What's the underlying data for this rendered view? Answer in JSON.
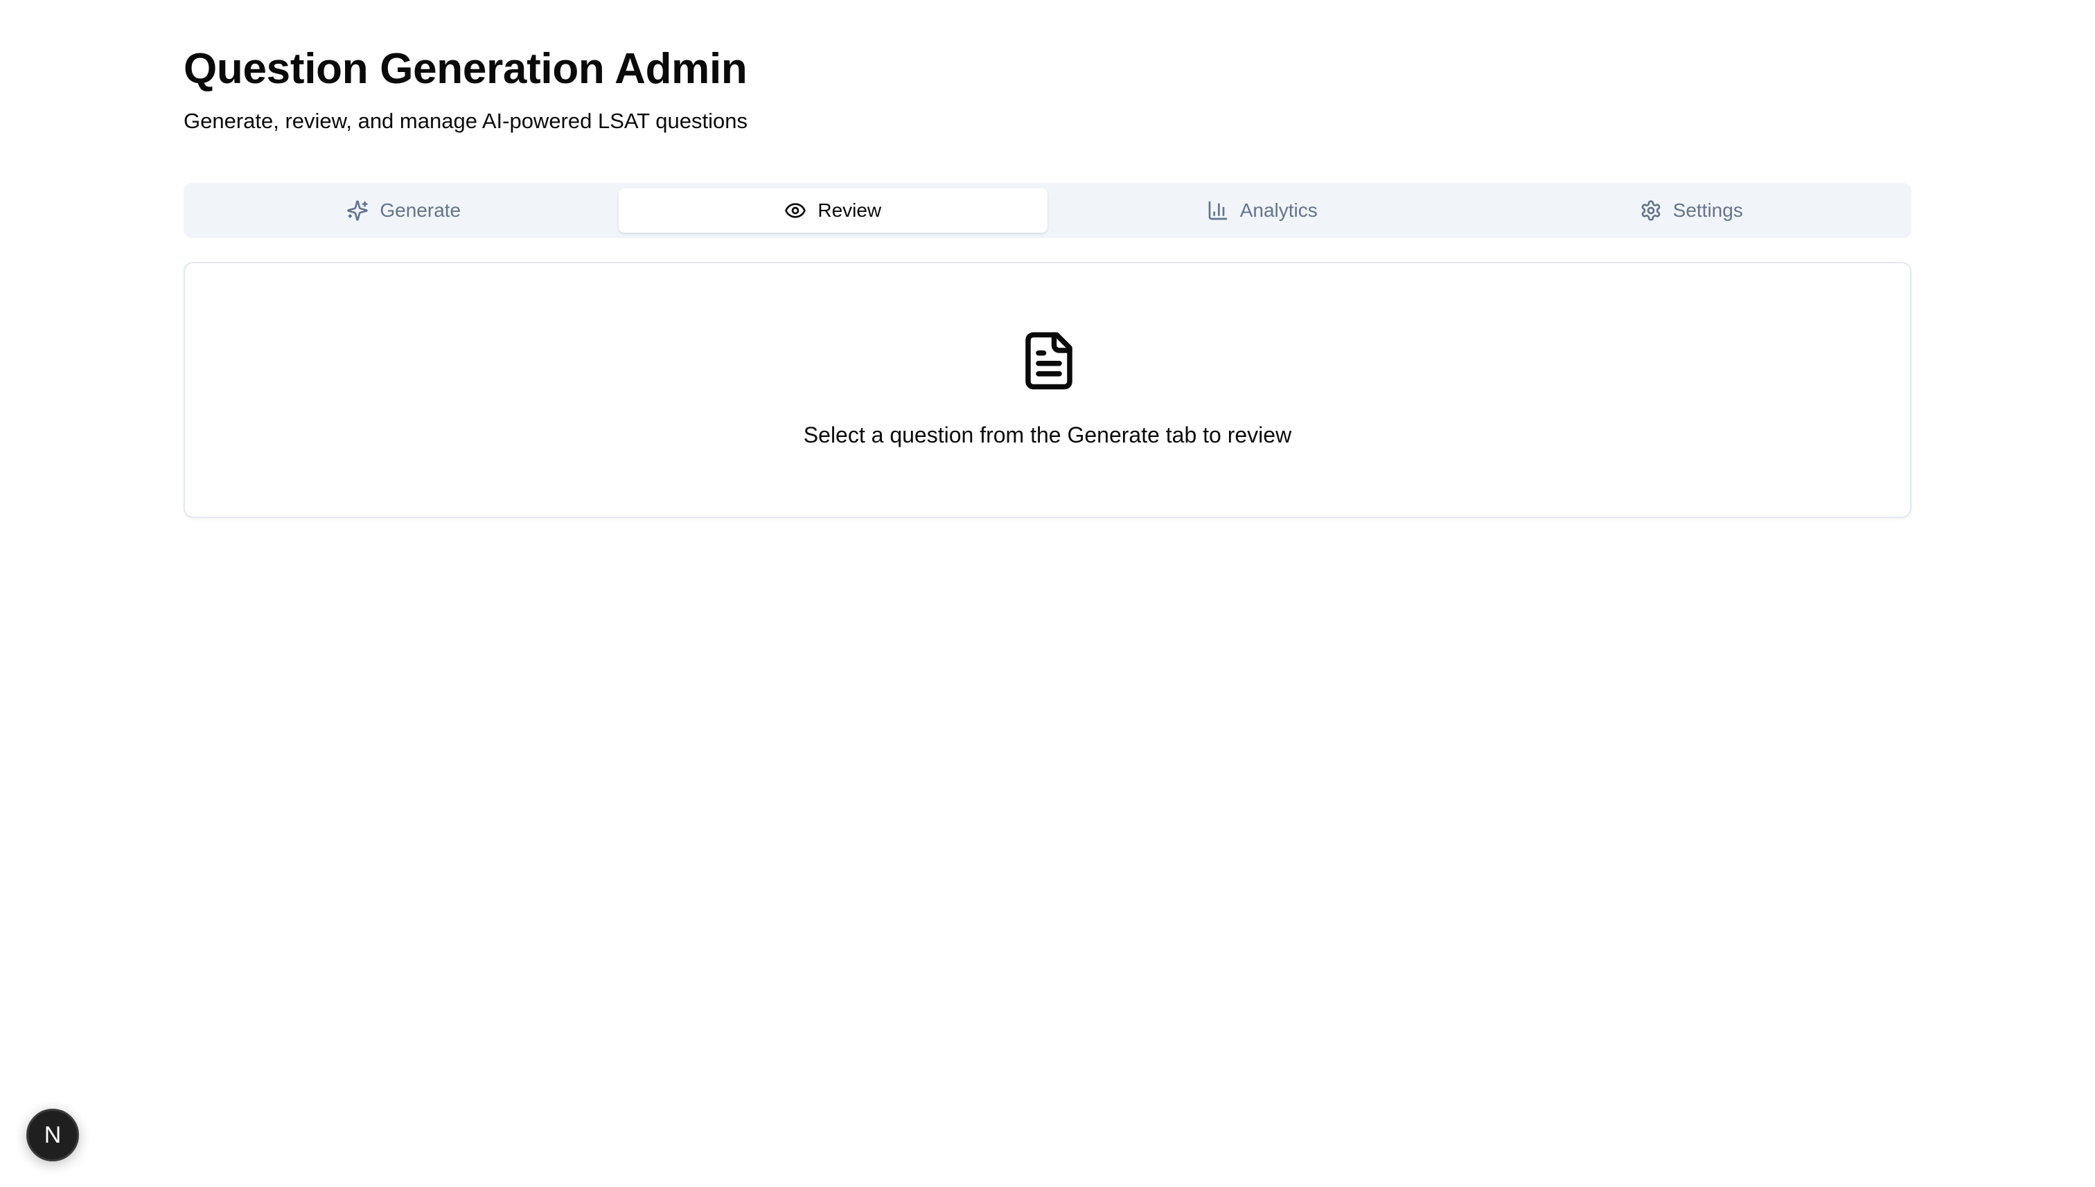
{
  "header": {
    "title": "Question Generation Admin",
    "subtitle": "Generate, review, and manage AI-powered LSAT questions"
  },
  "tabs": [
    {
      "label": "Generate",
      "icon": "sparkles-icon",
      "active": false
    },
    {
      "label": "Review",
      "icon": "eye-icon",
      "active": true
    },
    {
      "label": "Analytics",
      "icon": "bar-chart-icon",
      "active": false
    },
    {
      "label": "Settings",
      "icon": "gear-icon",
      "active": false
    }
  ],
  "review": {
    "empty_icon": "file-text-icon",
    "empty_message": "Select a question from the Generate tab to review"
  },
  "dev_badge": {
    "label": "N",
    "icon": "nextjs-logo-icon"
  },
  "colors": {
    "tab_list_bg": "#f1f5f9",
    "tab_inactive_text": "#64748b",
    "text": "#0a0a0a",
    "card_border": "#e2e8f0",
    "badge_bg": "#1f1f1f"
  }
}
